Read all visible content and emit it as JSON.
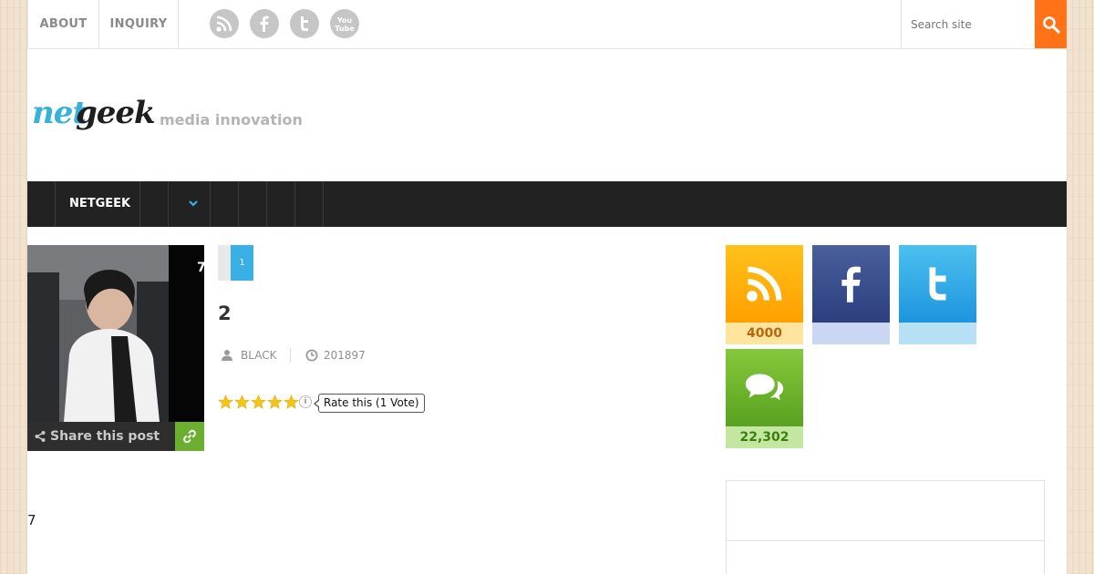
{
  "topbar": {
    "links": [
      "ABOUT",
      "INQUIRY"
    ],
    "social_icons": [
      "rss-icon",
      "facebook-icon",
      "twitter-icon",
      "youtube-icon"
    ],
    "youtube_text": "You Tube",
    "search_placeholder": "Search site"
  },
  "header": {
    "logo_part1": "net",
    "logo_part2": "geek",
    "tagline": "media innovation",
    "logo_colors": {
      "net": "#36b1d9",
      "geek": "#1e1e1e"
    }
  },
  "nav": {
    "items": [
      "NETGEEK"
    ],
    "dropdown_icon": "chevron-down-icon"
  },
  "post": {
    "thumbnail_vertical_text": "7",
    "share_label": "Share this post",
    "pagination": [
      "1"
    ],
    "title": "2",
    "author": "BLACK",
    "date": "201897",
    "rating": {
      "stars": 5,
      "max": 5,
      "label": "Rate this (1 Vote)"
    },
    "page_footer_number": "7"
  },
  "sidebar": {
    "social_counts": [
      {
        "name": "rss",
        "count": "4000",
        "color": "#ffaa00"
      },
      {
        "name": "facebook",
        "count": "",
        "color": "#3b4f8f"
      },
      {
        "name": "twitter",
        "count": "",
        "color": "#2aa7e6"
      },
      {
        "name": "comments",
        "count": "22,302",
        "color": "#6fb52c"
      }
    ]
  },
  "colors": {
    "accent_orange": "#ff7217",
    "accent_blue": "#38b0e6",
    "nav_bg": "#222222",
    "share_green": "#6aaf2f"
  }
}
